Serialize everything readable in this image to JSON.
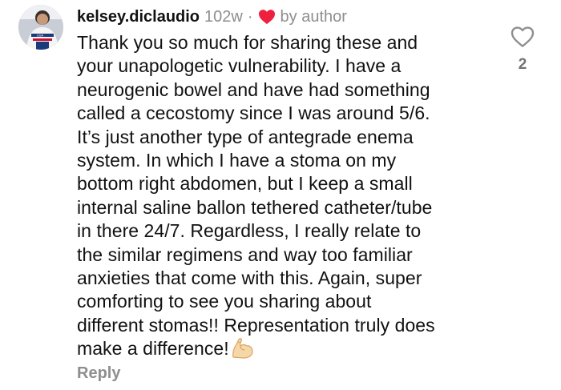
{
  "comment": {
    "username": "kelsey.diclaudio",
    "timestamp": "102w",
    "separator": "·",
    "author_like_label": "by author",
    "text": "Thank you so much for sharing these and\nyour unapologetic vulnerability. I have a\nneurogenic bowel and have had something\ncalled a cecostomy since I was around 5/6.\nIt’s just another type of  antegrade enema\nsystem. In which I have a stoma on my\nbottom right abdomen, but I keep a small\ninternal saline ballon tethered catheter/tube\nin there 24/7.  Regardless, I really relate to\nthe similar regimens and way too familiar\nanxieties that come with this. Again, super\ncomforting to see you sharing about\ndifferent stomas!! Representation truly does\nmake a difference!",
    "trailing_emoji": "flexed-biceps-icon",
    "reply_label": "Reply",
    "like_count": "2"
  },
  "colors": {
    "text_primary": "#111111",
    "text_secondary": "#8e8e8e",
    "author_heart": "#ed2040",
    "like_outline": "#8e8e8e"
  }
}
